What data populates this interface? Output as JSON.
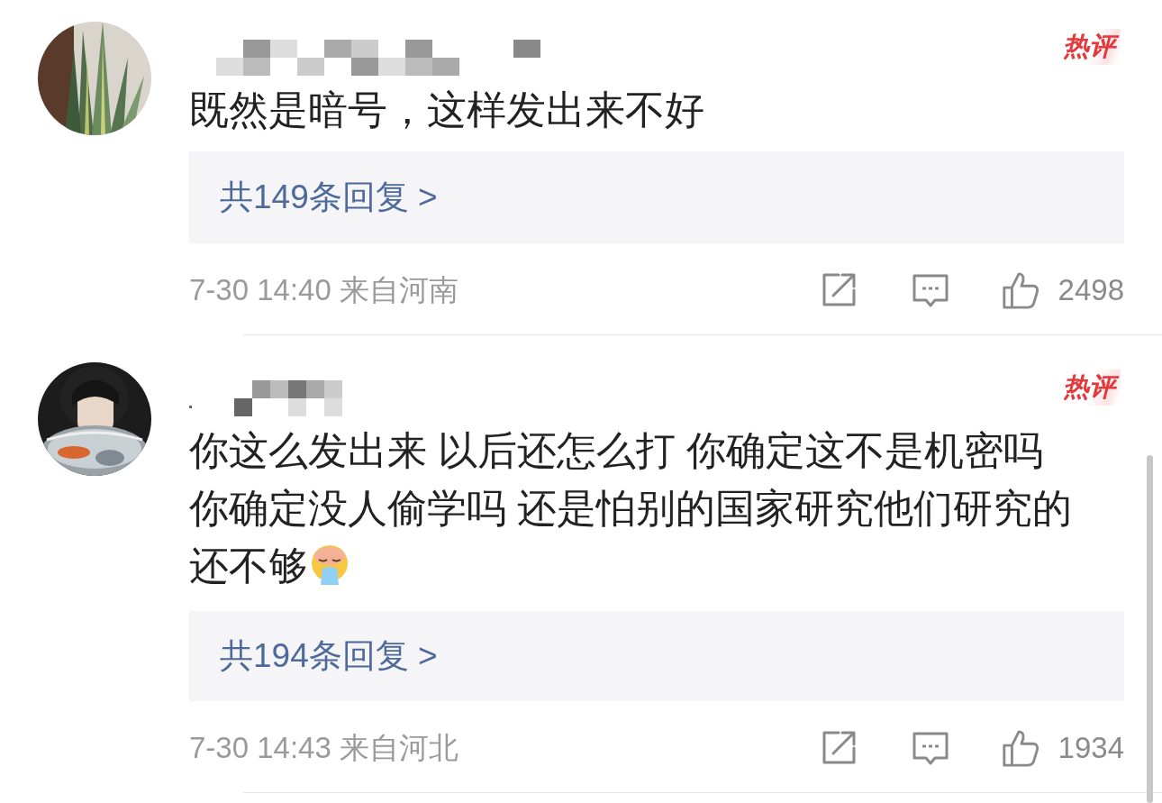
{
  "comments": [
    {
      "badge": "热评",
      "lines": [
        "既然是暗号，这样发出来不好"
      ],
      "emoji": false,
      "replies": "共149条回复 >",
      "time": "7-30 14:40",
      "source": "来自河南",
      "likes": "2498"
    },
    {
      "badge": "热评",
      "lines": [
        "你这么发出来 以后还怎么打 你确定这不是机密吗",
        "你确定没人偷学吗 还是怕别的国家研究他们研究的",
        "还不够"
      ],
      "emoji": true,
      "replies": "共194条回复 >",
      "time": "7-30 14:43",
      "source": "来自河北",
      "likes": "1934"
    }
  ]
}
